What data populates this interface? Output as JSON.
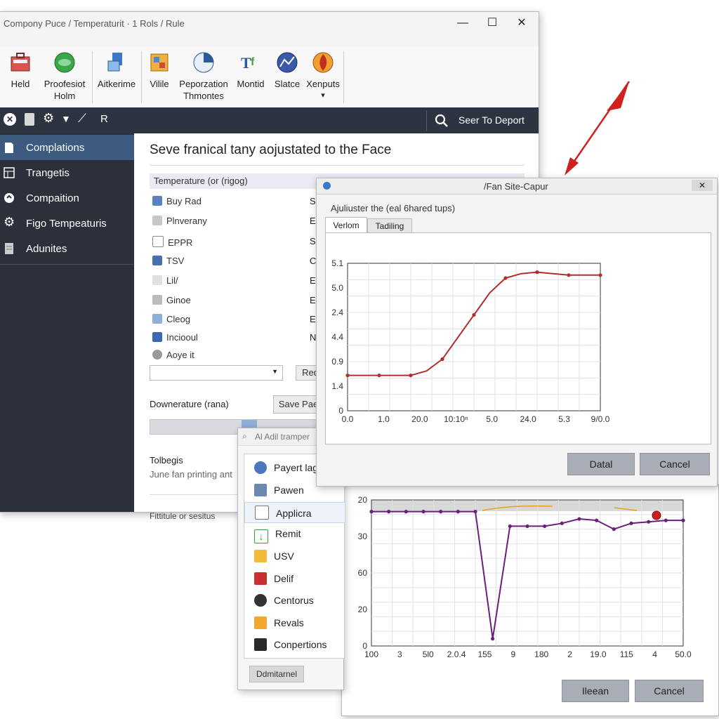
{
  "main_window": {
    "title": "Compony Puce / Temperaturit · 1 Rols / Rule",
    "ribbon": [
      {
        "label": "Held",
        "icon": "toolbox-icon"
      },
      {
        "label": "Proofesiot Holm",
        "icon": "green-globe-icon"
      },
      {
        "label": "Aitkerime",
        "icon": "monitor-icon"
      },
      {
        "label": "Vilile",
        "icon": "palette-icon"
      },
      {
        "label": "Peporzation Thmontes",
        "icon": "pie-icon"
      },
      {
        "label": "Montid",
        "icon": "text-format-icon"
      },
      {
        "label": "Slatce",
        "icon": "chart-circle-icon"
      },
      {
        "label": "Xenputs",
        "icon": "fire-globe-icon"
      }
    ],
    "ribbon_more": "▾",
    "search_label": "Seer To Deport",
    "sidebar": [
      {
        "label": "Complations",
        "icon": "document-icon"
      },
      {
        "label": "Trangetis",
        "icon": "table-icon"
      },
      {
        "label": "Compaition",
        "icon": "circle-arrows-icon"
      },
      {
        "label": "Figo Tempeaturis",
        "icon": "gear-icon"
      },
      {
        "label": "Adunites",
        "icon": "page-icon"
      }
    ],
    "heading": "Seve franical tany aojustated to the Face",
    "section_header": "Temperature (or (rigog)",
    "list": [
      {
        "label": "Buy Rad",
        "right": "S"
      },
      {
        "label": "Plnverany",
        "right": "E"
      },
      {
        "label": "EPPR",
        "right": "S"
      },
      {
        "label": "TSV",
        "right": "C"
      },
      {
        "label": "Lil/",
        "right": "E"
      },
      {
        "label": "Ginoe",
        "right": "E"
      },
      {
        "label": "Cleog",
        "right": "E"
      },
      {
        "label": "Inciooul",
        "right": "N"
      },
      {
        "label": "Aoye it",
        "right": ""
      }
    ],
    "small_btn": "Red",
    "downerature_label": "Downerature (rana)",
    "save_btn": "Save Pae",
    "tolbegis_label": "Tolbegis",
    "tolbegis_text": "June fan printing ant",
    "fittitule_label": "Fittitule or sesitus"
  },
  "dialog1": {
    "title": "/Fan Site-Capur",
    "instruction": "Ajuliuster the (eal 6hared tups)",
    "tabs": [
      "Verlom",
      "Tadiling"
    ],
    "btn_ok": "Datal",
    "btn_cancel": "Cancel"
  },
  "dialog2": {
    "title": "Al Adil tramper",
    "items": [
      {
        "label": "Payert lag",
        "icon": "globe-icon"
      },
      {
        "label": "Pawen",
        "icon": "shield-icon"
      },
      {
        "label": "Applicra",
        "icon": "app-icon"
      },
      {
        "label": "Remit",
        "icon": "download-icon"
      },
      {
        "label": "USV",
        "icon": "folder-icon"
      },
      {
        "label": "Delif",
        "icon": "delete-icon"
      },
      {
        "label": "Centorus",
        "icon": "camera-icon"
      },
      {
        "label": "Revals",
        "icon": "folder-icon"
      },
      {
        "label": "Conpertions",
        "icon": "puzzle-icon"
      }
    ],
    "button": "Ddmitarnel"
  },
  "dialog3": {
    "btn_ok": "Ileean",
    "btn_cancel": "Cancel"
  },
  "chart_data": [
    {
      "type": "line",
      "x_tick_labels": [
        "0.0",
        "1.0",
        "20.0",
        "10:10ⁿ",
        "5.0",
        "24.0",
        "5.3",
        "9/0.0"
      ],
      "y_tick_labels": [
        "5.1",
        "5.0",
        "2.4",
        "4.4",
        "0.9",
        "1.4",
        "0"
      ],
      "series": [
        {
          "color": "#b03030",
          "values": [
            0.24,
            0.24,
            0.24,
            0.24,
            0.24,
            0.27,
            0.35,
            0.5,
            0.65,
            0.8,
            0.9,
            0.93,
            0.94,
            0.93,
            0.92,
            0.92,
            0.92
          ]
        }
      ],
      "grid": true
    },
    {
      "type": "line",
      "x_tick_labels": [
        "100",
        "3",
        "5l0",
        "2.0.4",
        "155",
        "9",
        "180",
        "2",
        "19.0",
        "115",
        "4",
        "50.0"
      ],
      "y_tick_labels": [
        "20",
        "30",
        "60",
        "20",
        "0"
      ],
      "series": [
        {
          "color": "#6a1f78",
          "values": [
            0.92,
            0.92,
            0.92,
            0.92,
            0.92,
            0.92,
            0.92,
            0.05,
            0.82,
            0.82,
            0.82,
            0.84,
            0.87,
            0.86,
            0.8,
            0.84,
            0.85,
            0.86,
            0.86
          ]
        }
      ],
      "marker_color": "#cc2020",
      "grid": true
    }
  ],
  "colors": {
    "sidebar_bg": "#2b303b",
    "sidebar_active": "#3d5a80",
    "darkbar": "#2d3340",
    "arrow": "#d02020",
    "line1": "#b03030",
    "line2": "#6a1f78"
  }
}
